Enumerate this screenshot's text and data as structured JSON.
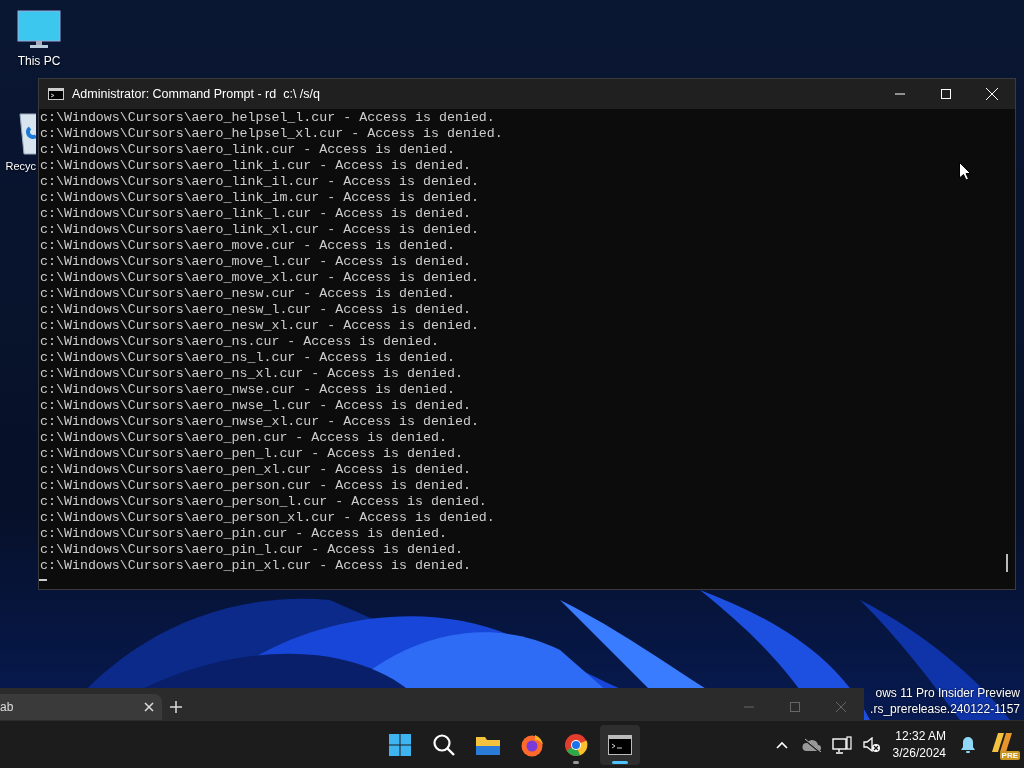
{
  "desktop_icons": [
    {
      "kind": "pc",
      "label": "This PC"
    },
    {
      "kind": "bin",
      "label": "Recyc"
    }
  ],
  "console": {
    "title": "Administrator: Command Prompt - rd  c:\\ /s/q",
    "lines": [
      "c:\\Windows\\Cursors\\aero_helpsel_l.cur - Access is denied.",
      "c:\\Windows\\Cursors\\aero_helpsel_xl.cur - Access is denied.",
      "c:\\Windows\\Cursors\\aero_link.cur - Access is denied.",
      "c:\\Windows\\Cursors\\aero_link_i.cur - Access is denied.",
      "c:\\Windows\\Cursors\\aero_link_il.cur - Access is denied.",
      "c:\\Windows\\Cursors\\aero_link_im.cur - Access is denied.",
      "c:\\Windows\\Cursors\\aero_link_l.cur - Access is denied.",
      "c:\\Windows\\Cursors\\aero_link_xl.cur - Access is denied.",
      "c:\\Windows\\Cursors\\aero_move.cur - Access is denied.",
      "c:\\Windows\\Cursors\\aero_move_l.cur - Access is denied.",
      "c:\\Windows\\Cursors\\aero_move_xl.cur - Access is denied.",
      "c:\\Windows\\Cursors\\aero_nesw.cur - Access is denied.",
      "c:\\Windows\\Cursors\\aero_nesw_l.cur - Access is denied.",
      "c:\\Windows\\Cursors\\aero_nesw_xl.cur - Access is denied.",
      "c:\\Windows\\Cursors\\aero_ns.cur - Access is denied.",
      "c:\\Windows\\Cursors\\aero_ns_l.cur - Access is denied.",
      "c:\\Windows\\Cursors\\aero_ns_xl.cur - Access is denied.",
      "c:\\Windows\\Cursors\\aero_nwse.cur - Access is denied.",
      "c:\\Windows\\Cursors\\aero_nwse_l.cur - Access is denied.",
      "c:\\Windows\\Cursors\\aero_nwse_xl.cur - Access is denied.",
      "c:\\Windows\\Cursors\\aero_pen.cur - Access is denied.",
      "c:\\Windows\\Cursors\\aero_pen_l.cur - Access is denied.",
      "c:\\Windows\\Cursors\\aero_pen_xl.cur - Access is denied.",
      "c:\\Windows\\Cursors\\aero_person.cur - Access is denied.",
      "c:\\Windows\\Cursors\\aero_person_l.cur - Access is denied.",
      "c:\\Windows\\Cursors\\aero_person_xl.cur - Access is denied.",
      "c:\\Windows\\Cursors\\aero_pin.cur - Access is denied.",
      "c:\\Windows\\Cursors\\aero_pin_l.cur - Access is denied.",
      "c:\\Windows\\Cursors\\aero_pin_xl.cur - Access is denied."
    ]
  },
  "background_window": {
    "tabs": [
      {
        "label": "ab",
        "selected": true
      }
    ]
  },
  "watermark": [
    "ows 11 Pro Insider Preview",
    ".rs_prerelease.240122-1157"
  ],
  "taskbar": {
    "apps": [
      {
        "kind": "start",
        "selected": false,
        "running": false
      },
      {
        "kind": "search",
        "selected": false,
        "running": false
      },
      {
        "kind": "explorer",
        "selected": false,
        "running": false
      },
      {
        "kind": "firefox",
        "selected": false,
        "running": false
      },
      {
        "kind": "chrome",
        "selected": false,
        "running": true
      },
      {
        "kind": "terminal",
        "selected": true,
        "running": true
      }
    ],
    "time": "12:32 AM",
    "date": "3/26/2024",
    "badge": "PRE"
  }
}
